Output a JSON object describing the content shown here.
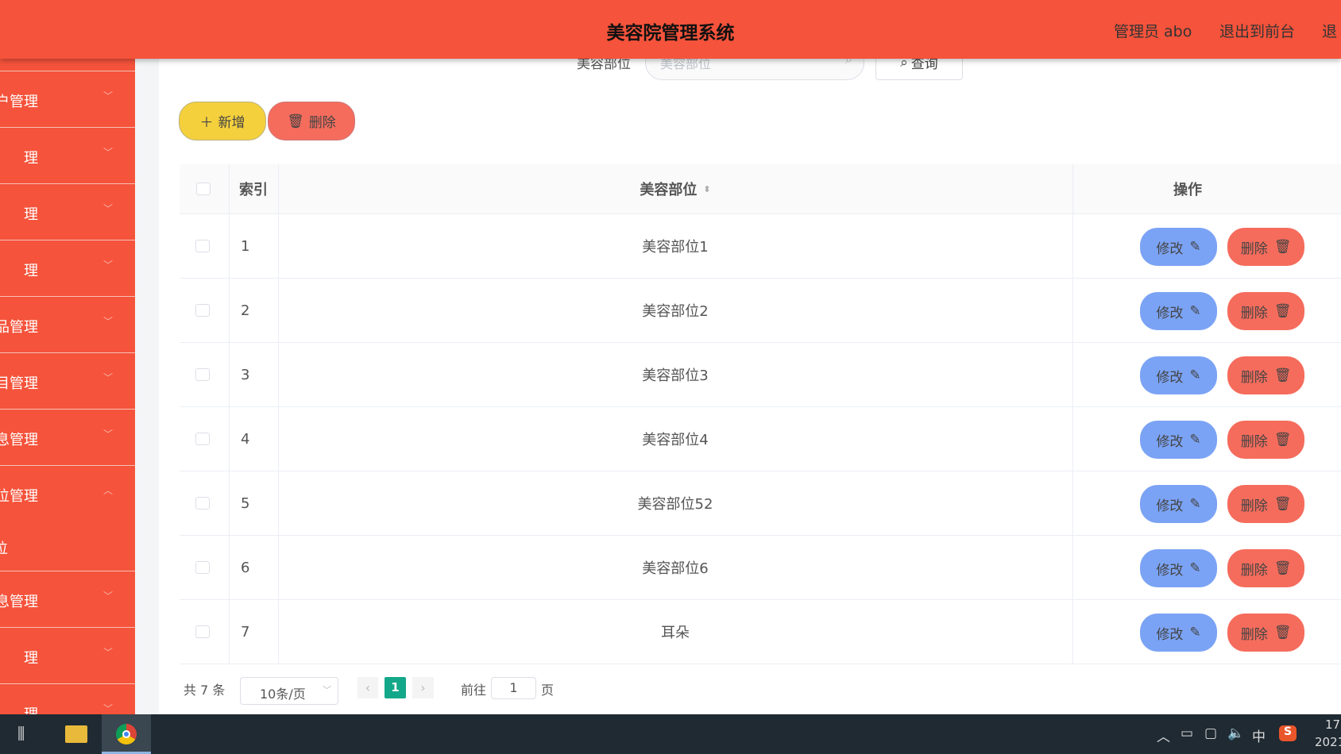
{
  "header": {
    "title": "美容院管理系统",
    "user": "管理员 abo",
    "front": "退出到前台",
    "logout_partial": "退"
  },
  "sidebar": {
    "items": [
      {
        "label": "户管理",
        "expanded": false
      },
      {
        "label": "理",
        "expanded": false
      },
      {
        "label": "理",
        "expanded": false
      },
      {
        "label": "理",
        "expanded": false
      },
      {
        "label": "品管理",
        "expanded": false
      },
      {
        "label": "目管理",
        "expanded": false
      },
      {
        "label": "息管理",
        "expanded": false
      },
      {
        "label": "位管理",
        "expanded": true,
        "sub": "位"
      },
      {
        "label": "息管理",
        "expanded": false
      },
      {
        "label": "理",
        "expanded": false
      },
      {
        "label": "理",
        "expanded": false
      }
    ]
  },
  "search": {
    "label": "美容部位",
    "placeholder": "美容部位",
    "button": "查询"
  },
  "toolbar": {
    "add": "新增",
    "delete": "删除"
  },
  "table": {
    "headers": {
      "index": "索引",
      "part": "美容部位",
      "ops": "操作"
    },
    "rows": [
      {
        "index": "1",
        "part": "美容部位1"
      },
      {
        "index": "2",
        "part": "美容部位2"
      },
      {
        "index": "3",
        "part": "美容部位3"
      },
      {
        "index": "4",
        "part": "美容部位4"
      },
      {
        "index": "5",
        "part": "美容部位52"
      },
      {
        "index": "6",
        "part": "美容部位6"
      },
      {
        "index": "7",
        "part": "耳朵"
      }
    ],
    "edit": "修改",
    "remove": "删除"
  },
  "pagination": {
    "total": "共 7 条",
    "page_size": "10条/页",
    "current": "1",
    "goto": "前往",
    "goto_value": "1",
    "page_unit": "页"
  },
  "taskbar": {
    "ime": "中",
    "time": "17",
    "date": "2021"
  },
  "colors": {
    "header": "#f5533b",
    "add": "#f5d03d",
    "delete": "#f56c5c",
    "edit": "#7ba3f5",
    "page_active": "#14a88a"
  }
}
